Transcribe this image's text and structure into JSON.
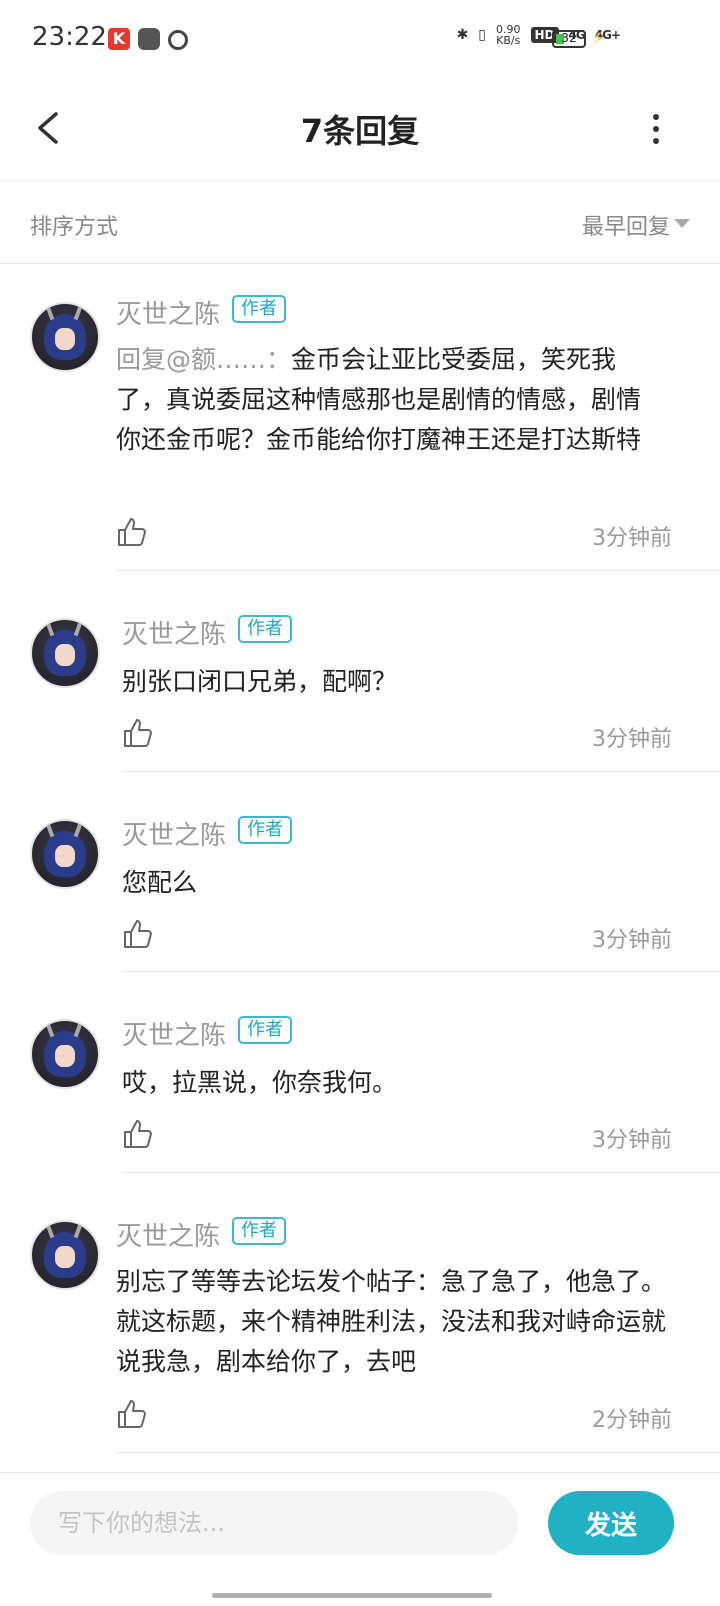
{
  "status_bar": {
    "time": "23:22",
    "app_k": "K",
    "speed_value": "0.90",
    "speed_unit": "KB/s",
    "hd": "HD",
    "sig1": "4G",
    "sig2": "4G+",
    "battery": "32"
  },
  "header": {
    "title": "7条回复"
  },
  "sort": {
    "label": "排序方式",
    "value": "最早回复"
  },
  "comments": [
    {
      "username": "灭世之陈",
      "badge": "作者",
      "mention": "回复@额……：",
      "text": "金币会让亚比受委屈，笑死我了，真说委屈这种情感那也是剧情的情感，剧情你还金币呢？金币能给你打魔神王还是打达斯特",
      "time": "3分钟前"
    },
    {
      "username": "灭世之陈",
      "badge": "作者",
      "text": "别张口闭口兄弟，配啊？",
      "time": "3分钟前"
    },
    {
      "username": "灭世之陈",
      "badge": "作者",
      "text": "您配么",
      "time": "3分钟前"
    },
    {
      "username": "灭世之陈",
      "badge": "作者",
      "text": "哎，拉黑说，你奈我何。",
      "time": "3分钟前"
    },
    {
      "username": "灭世之陈",
      "badge": "作者",
      "text": "别忘了等等去论坛发个帖子：急了急了，他急了。就这标题，来个精神胜利法，没法和我对峙命运就说我急，剧本给你了，去吧",
      "time": "2分钟前"
    }
  ],
  "footer": {
    "placeholder": "写下你的想法...",
    "send_label": "发送"
  }
}
